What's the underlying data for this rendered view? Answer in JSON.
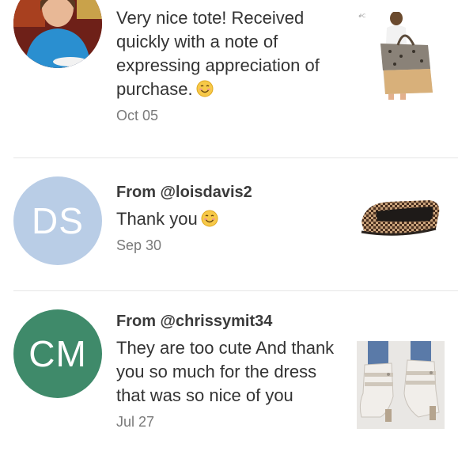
{
  "reviews": [
    {
      "from": "",
      "text": "Very nice tote! Received quickly with a note of expressing appreciation of purchase.",
      "emoji": "smiling-face-emoji",
      "date": "Oct 05",
      "avatar": {
        "type": "photo",
        "bg": "#8a2a1e"
      },
      "thumb_tag": "#C"
    },
    {
      "from": "From @loisdavis2",
      "text": "Thank you",
      "emoji": "smiling-face-emoji",
      "date": "Sep 30",
      "avatar": {
        "type": "initials",
        "initials": "DS",
        "bg": "#b9cde6"
      }
    },
    {
      "from": "From @chrissymit34",
      "text": "They are too cute And thank you so much for the dress that was so nice of you",
      "date": "Jul 27",
      "avatar": {
        "type": "initials",
        "initials": "CM",
        "bg": "#3f8a6a"
      }
    }
  ]
}
